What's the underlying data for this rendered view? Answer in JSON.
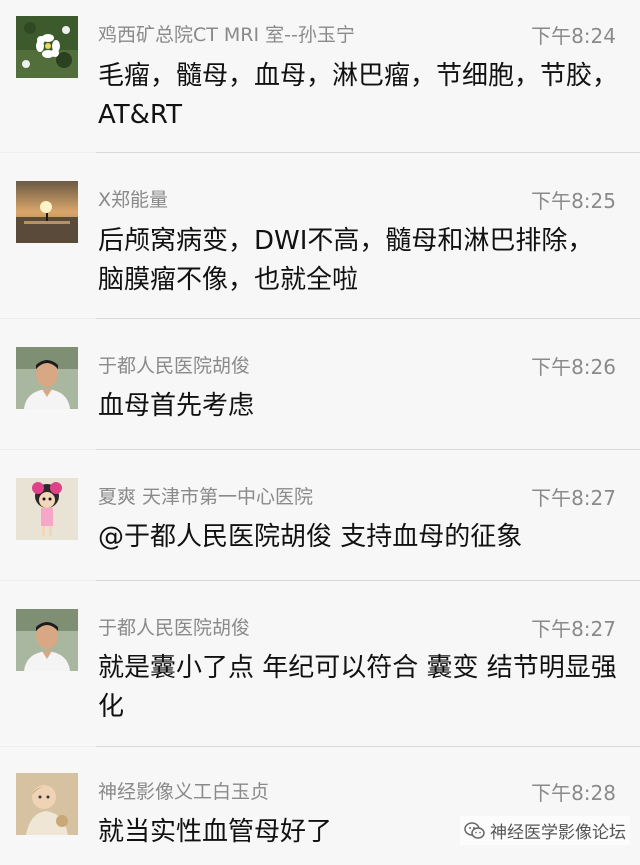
{
  "messages": [
    {
      "name": "鸡西矿总院CT MRI 室--孙玉宁",
      "time": "下午8:24",
      "text": "毛瘤，髓母，血母，淋巴瘤，节细胞，节胶，AT&RT",
      "avatar_icon": "flower-avatar-icon"
    },
    {
      "name": "X郑能量",
      "time": "下午8:25",
      "text": "后颅窝病变，DWI不高，髓母和淋巴排除，脑膜瘤不像，也就全啦",
      "avatar_icon": "sunset-avatar-icon"
    },
    {
      "name": "于都人民医院胡俊",
      "time": "下午8:26",
      "text": "血母首先考虑",
      "avatar_icon": "man-portrait-avatar-icon"
    },
    {
      "name": "夏爽 天津市第一中心医院",
      "time": "下午8:27",
      "text": "@于都人民医院胡俊 支持血母的征象",
      "avatar_icon": "cartoon-doll-avatar-icon"
    },
    {
      "name": "于都人民医院胡俊",
      "time": "下午8:27",
      "text": "就是囊小了点 年纪可以符合 囊变 结节明显强化",
      "avatar_icon": "man-portrait-avatar-icon"
    },
    {
      "name": "神经影像义工白玉贞",
      "time": "下午8:28",
      "text": "就当实性血管母好了",
      "avatar_icon": "child-avatar-icon"
    }
  ],
  "watermark": {
    "text": "神经医学影像论坛",
    "icon": "wechat-icon"
  }
}
